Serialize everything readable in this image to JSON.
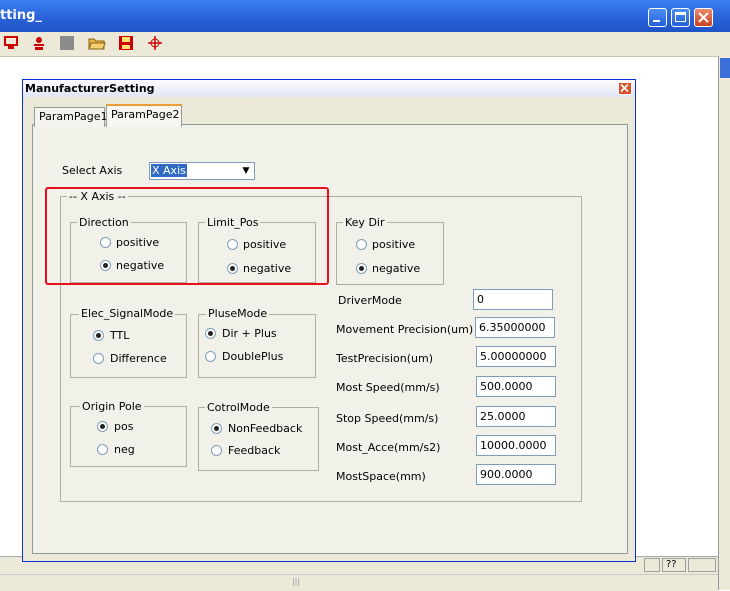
{
  "window": {
    "title_fragment": "tting_",
    "statusbar_cell": "??"
  },
  "dialog": {
    "title": "ManufacturerSetting",
    "tabs": [
      {
        "label": "ParamPage1",
        "active": false
      },
      {
        "label": "ParamPage2",
        "active": true
      }
    ],
    "select_axis": {
      "label": "Select Axis",
      "value": "X Axis"
    },
    "axis_group_title": "-- X Axis --",
    "direction": {
      "title": "Direction",
      "options": [
        "positive",
        "negative"
      ],
      "selected": "negative"
    },
    "limit_pos": {
      "title": "Limit_Pos",
      "options": [
        "positive",
        "negative"
      ],
      "selected": "negative"
    },
    "key_dir": {
      "title": "Key Dir",
      "options": [
        "positive",
        "negative"
      ],
      "selected": "negative"
    },
    "elec_signal_mode": {
      "title": "Elec_SignalMode",
      "options": [
        "TTL",
        "Difference"
      ],
      "selected": "TTL"
    },
    "pluse_mode": {
      "title": "PluseMode",
      "options": [
        "Dir + Plus",
        "DoublePlus"
      ],
      "selected": "Dir + Plus"
    },
    "origin_pole": {
      "title": "Origin Pole",
      "options": [
        "pos",
        "neg"
      ],
      "selected": "pos"
    },
    "cotrol_mode": {
      "title": "CotrolMode",
      "options": [
        "NonFeedback",
        "Feedback"
      ],
      "selected": "NonFeedback"
    },
    "fields": [
      {
        "label": "DriverMode",
        "value": "0"
      },
      {
        "label": "Movement Precision(um)",
        "value": "6.35000000"
      },
      {
        "label": "TestPrecision(um)",
        "value": "5.00000000"
      },
      {
        "label": "Most Speed(mm/s)",
        "value": "500.0000"
      },
      {
        "label": "Stop Speed(mm/s)",
        "value": "25.0000"
      },
      {
        "label": "Most_Acce(mm/s2)",
        "value": "10000.0000"
      },
      {
        "label": "MostSpace(mm)",
        "value": "900.0000"
      }
    ]
  },
  "colors": {
    "xp_titlebar": "#2a62d8",
    "dialog_face": "#ece9d8",
    "selection": "#316ac5",
    "highlight_annotation": "#e8101c"
  },
  "icons": [
    "open-folder-icon",
    "save-icon",
    "crosshair-icon",
    "monitor-icon",
    "tool-icon"
  ]
}
